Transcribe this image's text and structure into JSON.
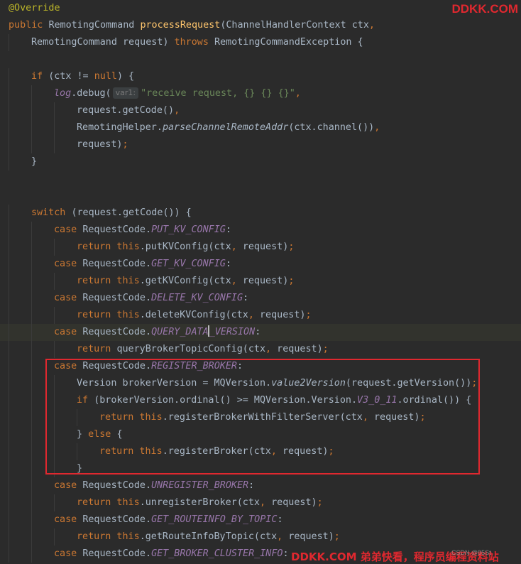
{
  "watermarks": {
    "top": "DDKK.COM",
    "bottom": "DDKK.COM 弟弟快看，程序员编程资料站",
    "csdn": "CSDN @95St"
  },
  "colors": {
    "background": "#2b2b2b",
    "keyword": "#cc7832",
    "method": "#ffc66d",
    "constant": "#9876aa",
    "string": "#6a8759",
    "annotation": "#bbb529",
    "text": "#a9b7c6",
    "highlight_box": "#e0282f"
  },
  "code_lines": [
    {
      "indent": 0,
      "tokens": [
        {
          "t": "@Override",
          "c": "ann"
        }
      ]
    },
    {
      "indent": 0,
      "tokens": [
        {
          "t": "public ",
          "c": "kw"
        },
        {
          "t": "RemotingCommand "
        },
        {
          "t": "processRequest",
          "c": "fn"
        },
        {
          "t": "(ChannelHandlerContext ctx"
        },
        {
          "t": ",",
          "c": "kw"
        }
      ]
    },
    {
      "indent": 1,
      "tokens": [
        {
          "t": "RemotingCommand request) "
        },
        {
          "t": "throws ",
          "c": "kw"
        },
        {
          "t": "RemotingCommandException {"
        }
      ]
    },
    {
      "indent": 0,
      "tokens": []
    },
    {
      "indent": 1,
      "tokens": [
        {
          "t": "if ",
          "c": "kw"
        },
        {
          "t": "(ctx != "
        },
        {
          "t": "null",
          "c": "kw"
        },
        {
          "t": ") {"
        }
      ]
    },
    {
      "indent": 2,
      "tokens": [
        {
          "t": "log",
          "c": "log"
        },
        {
          "t": ".debug("
        },
        {
          "hint": "var1:"
        },
        {
          "t": "\"receive request, {} {} {}\"",
          "c": "str"
        },
        {
          "t": ",",
          "c": "kw"
        }
      ]
    },
    {
      "indent": 3,
      "tokens": [
        {
          "t": "request.getCode()"
        },
        {
          "t": ",",
          "c": "kw"
        }
      ]
    },
    {
      "indent": 3,
      "tokens": [
        {
          "t": "RemotingHelper."
        },
        {
          "t": "parseChannelRemoteAddr",
          "c": "it"
        },
        {
          "t": "(ctx.channel())"
        },
        {
          "t": ",",
          "c": "kw"
        }
      ]
    },
    {
      "indent": 3,
      "tokens": [
        {
          "t": "request)"
        },
        {
          "t": ";",
          "c": "kw"
        }
      ]
    },
    {
      "indent": 1,
      "tokens": [
        {
          "t": "}"
        }
      ]
    },
    {
      "indent": 0,
      "tokens": []
    },
    {
      "indent": 0,
      "tokens": []
    },
    {
      "indent": 1,
      "tokens": [
        {
          "t": "switch ",
          "c": "kw"
        },
        {
          "t": "(request.getCode()) {"
        }
      ]
    },
    {
      "indent": 2,
      "tokens": [
        {
          "t": "case ",
          "c": "kw"
        },
        {
          "t": "RequestCode."
        },
        {
          "t": "PUT_KV_CONFIG",
          "c": "cst"
        },
        {
          "t": ":"
        }
      ]
    },
    {
      "indent": 3,
      "tokens": [
        {
          "t": "return this",
          "c": "kw"
        },
        {
          "t": ".putKVConfig(ctx"
        },
        {
          "t": ", ",
          "c": "kw"
        },
        {
          "t": "request)"
        },
        {
          "t": ";",
          "c": "kw"
        }
      ]
    },
    {
      "indent": 2,
      "tokens": [
        {
          "t": "case ",
          "c": "kw"
        },
        {
          "t": "RequestCode."
        },
        {
          "t": "GET_KV_CONFIG",
          "c": "cst"
        },
        {
          "t": ":"
        }
      ]
    },
    {
      "indent": 3,
      "tokens": [
        {
          "t": "return this",
          "c": "kw"
        },
        {
          "t": ".getKVConfig(ctx"
        },
        {
          "t": ", ",
          "c": "kw"
        },
        {
          "t": "request)"
        },
        {
          "t": ";",
          "c": "kw"
        }
      ]
    },
    {
      "indent": 2,
      "tokens": [
        {
          "t": "case ",
          "c": "kw"
        },
        {
          "t": "RequestCode."
        },
        {
          "t": "DELETE_KV_CONFIG",
          "c": "cst"
        },
        {
          "t": ":"
        }
      ]
    },
    {
      "indent": 3,
      "tokens": [
        {
          "t": "return this",
          "c": "kw"
        },
        {
          "t": ".deleteKVConfig(ctx"
        },
        {
          "t": ", ",
          "c": "kw"
        },
        {
          "t": "request)"
        },
        {
          "t": ";",
          "c": "kw"
        }
      ]
    },
    {
      "indent": 2,
      "current": true,
      "tokens": [
        {
          "t": "case ",
          "c": "kw"
        },
        {
          "t": "RequestCode."
        },
        {
          "t": "QUERY_DATA",
          "c": "cst"
        },
        {
          "cursor": true
        },
        {
          "t": "_VERSION",
          "c": "cst"
        },
        {
          "t": ":"
        }
      ]
    },
    {
      "indent": 3,
      "tokens": [
        {
          "t": "return ",
          "c": "kw"
        },
        {
          "t": "queryBrokerTopicConfig(ctx"
        },
        {
          "t": ", ",
          "c": "kw"
        },
        {
          "t": "request)"
        },
        {
          "t": ";",
          "c": "kw"
        }
      ]
    },
    {
      "indent": 2,
      "tokens": [
        {
          "t": "case ",
          "c": "kw"
        },
        {
          "t": "RequestCode."
        },
        {
          "t": "REGISTER_BROKER",
          "c": "cst"
        },
        {
          "t": ":"
        }
      ]
    },
    {
      "indent": 3,
      "tokens": [
        {
          "t": "Version brokerVersion = MQVersion."
        },
        {
          "t": "value2Version",
          "c": "it"
        },
        {
          "t": "(request.getVersion())"
        },
        {
          "t": ";",
          "c": "kw"
        }
      ]
    },
    {
      "indent": 3,
      "tokens": [
        {
          "t": "if ",
          "c": "kw"
        },
        {
          "t": "(brokerVersion.ordinal() >= MQVersion.Version."
        },
        {
          "t": "V3_0_11",
          "c": "cst"
        },
        {
          "t": ".ordinal()) {"
        }
      ]
    },
    {
      "indent": 4,
      "tokens": [
        {
          "t": "return this",
          "c": "kw"
        },
        {
          "t": ".registerBrokerWithFilterServer(ctx"
        },
        {
          "t": ", ",
          "c": "kw"
        },
        {
          "t": "request)"
        },
        {
          "t": ";",
          "c": "kw"
        }
      ]
    },
    {
      "indent": 3,
      "tokens": [
        {
          "t": "} "
        },
        {
          "t": "else ",
          "c": "kw"
        },
        {
          "t": "{"
        }
      ]
    },
    {
      "indent": 4,
      "tokens": [
        {
          "t": "return this",
          "c": "kw"
        },
        {
          "t": ".registerBroker(ctx"
        },
        {
          "t": ", ",
          "c": "kw"
        },
        {
          "t": "request)"
        },
        {
          "t": ";",
          "c": "kw"
        }
      ]
    },
    {
      "indent": 3,
      "tokens": [
        {
          "t": "}"
        }
      ]
    },
    {
      "indent": 2,
      "tokens": [
        {
          "t": "case ",
          "c": "kw"
        },
        {
          "t": "RequestCode."
        },
        {
          "t": "UNREGISTER_BROKER",
          "c": "cst"
        },
        {
          "t": ":"
        }
      ]
    },
    {
      "indent": 3,
      "tokens": [
        {
          "t": "return this",
          "c": "kw"
        },
        {
          "t": ".unregisterBroker(ctx"
        },
        {
          "t": ", ",
          "c": "kw"
        },
        {
          "t": "request)"
        },
        {
          "t": ";",
          "c": "kw"
        }
      ]
    },
    {
      "indent": 2,
      "tokens": [
        {
          "t": "case ",
          "c": "kw"
        },
        {
          "t": "RequestCode."
        },
        {
          "t": "GET_ROUTEINFO_BY_TOPIC",
          "c": "cst"
        },
        {
          "t": ":"
        }
      ]
    },
    {
      "indent": 3,
      "tokens": [
        {
          "t": "return this",
          "c": "kw"
        },
        {
          "t": ".getRouteInfoByTopic(ctx"
        },
        {
          "t": ", ",
          "c": "kw"
        },
        {
          "t": "request)"
        },
        {
          "t": ";",
          "c": "kw"
        }
      ]
    },
    {
      "indent": 2,
      "tokens": [
        {
          "t": "case ",
          "c": "kw"
        },
        {
          "t": "RequestCode."
        },
        {
          "t": "GET_BROKER_CLUSTER_INFO",
          "c": "cst"
        },
        {
          "t": ":"
        }
      ]
    }
  ]
}
